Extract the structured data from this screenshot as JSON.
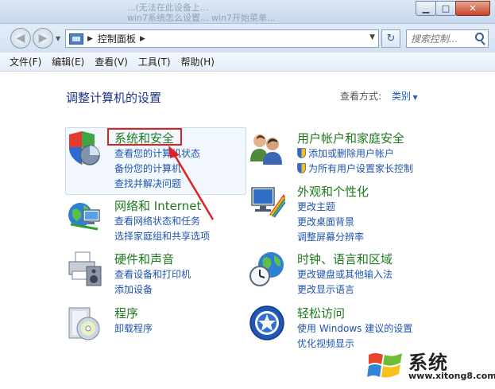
{
  "window": {
    "background_text_1": "...(无法在此设备上...",
    "background_text_2": "win7系统怎么设置... win7开始菜单...",
    "minimize": "▁",
    "maximize": "□",
    "close": "✕"
  },
  "navigation": {
    "address_crumb": "控制面板",
    "search_placeholder": "搜索控制..."
  },
  "menu": {
    "items": [
      "文件(F)",
      "编辑(E)",
      "查看(V)",
      "工具(T)",
      "帮助(H)"
    ]
  },
  "page": {
    "title": "调整计算机的设置",
    "view_by_label": "查看方式:",
    "view_by_value": "类别"
  },
  "categories": [
    {
      "title": "系统和安全",
      "links": [
        "查看您的计算机状态",
        "备份您的计算机",
        "查找并解决问题"
      ]
    },
    {
      "title": "网络和 Internet",
      "links": [
        "查看网络状态和任务",
        "选择家庭组和共享选项"
      ]
    },
    {
      "title": "硬件和声音",
      "links": [
        "查看设备和打印机",
        "添加设备"
      ]
    },
    {
      "title": "程序",
      "links": [
        "卸载程序"
      ]
    },
    {
      "title": "用户帐户和家庭安全",
      "links": [
        "添加或删除用户帐户",
        "为所有用户设置家长控制"
      ]
    },
    {
      "title": "外观和个性化",
      "links": [
        "更改主题",
        "更改桌面背景",
        "调整屏幕分辨率"
      ]
    },
    {
      "title": "时钟、语言和区域",
      "links": [
        "更改键盘或其他输入法",
        "更改显示语言"
      ]
    },
    {
      "title": "轻松访问",
      "links": [
        "使用 Windows 建议的设置",
        "优化视频显示"
      ]
    }
  ],
  "watermark": {
    "brand": "系统",
    "url": "www.xitong8.com"
  },
  "colors": {
    "category_title": "#1e7a1e",
    "link": "#1f54b0",
    "page_title": "#1e3287",
    "annotation_red": "#e02020"
  }
}
